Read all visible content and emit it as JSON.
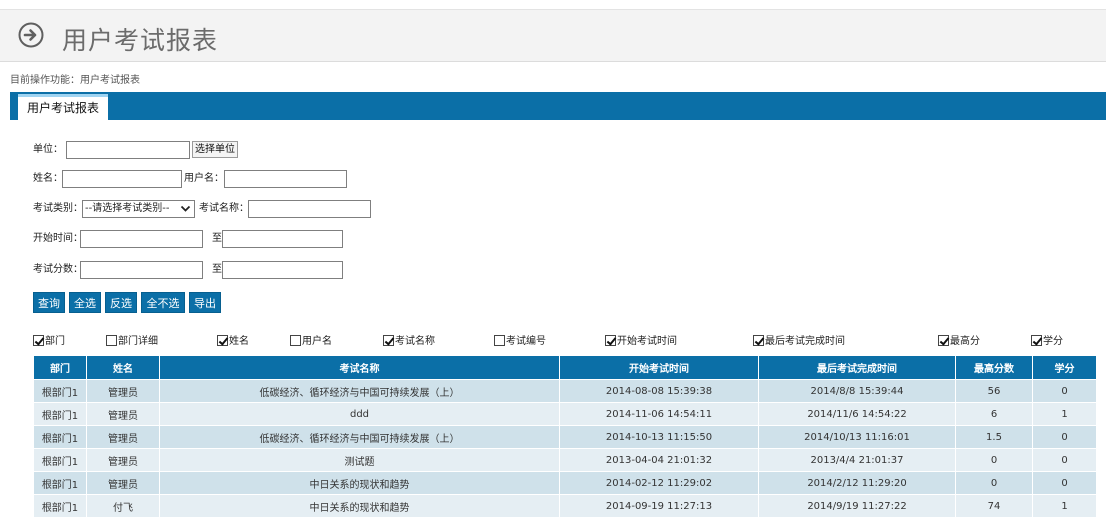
{
  "page": {
    "title": "用户考试报表",
    "breadcrumb": "目前操作功能：用户考试报表"
  },
  "tabs": [
    {
      "label": "用户考试报表",
      "active": true
    }
  ],
  "form": {
    "unit_label": "单位：",
    "unit_value": "",
    "unit_button": "选择单位",
    "name_label": "姓名：",
    "name_value": "",
    "username_label": "用户名：",
    "username_value": "",
    "category_label": "考试类别：",
    "category_selected": "--请选择考试类别--",
    "exam_name_label": "考试名称：",
    "exam_name_value": "",
    "start_label": "开始时间：",
    "start_from": "",
    "to_label": "至",
    "start_to": "",
    "score_label": "考试分数：",
    "score_from": "",
    "score_to": ""
  },
  "buttons": {
    "query": "查询",
    "select_all": "全选",
    "invert": "反选",
    "select_none": "全不选",
    "export": "导出"
  },
  "columns_toggle": [
    {
      "label": "部门",
      "checked": true
    },
    {
      "label": "部门详细",
      "checked": false
    },
    {
      "label": "姓名",
      "checked": true
    },
    {
      "label": "用户名",
      "checked": false
    },
    {
      "label": "考试名称",
      "checked": true
    },
    {
      "label": "考试编号",
      "checked": false
    },
    {
      "label": "开始考试时间",
      "checked": true
    },
    {
      "label": "最后考试完成时间",
      "checked": true
    },
    {
      "label": "最高分",
      "checked": true
    },
    {
      "label": "学分",
      "checked": true
    }
  ],
  "table": {
    "headers": [
      "部门",
      "姓名",
      "考试名称",
      "开始考试时间",
      "最后考试完成时间",
      "最高分数",
      "学分"
    ],
    "rows": [
      [
        "根部门1",
        "管理员",
        "低碳经济、循环经济与中国可持续发展（上）",
        "2014-08-08 15:39:38",
        "2014/8/8 15:39:44",
        "56",
        "0"
      ],
      [
        "根部门1",
        "管理员",
        "ddd",
        "2014-11-06 14:54:11",
        "2014/11/6 14:54:22",
        "6",
        "1"
      ],
      [
        "根部门1",
        "管理员",
        "低碳经济、循环经济与中国可持续发展（上）",
        "2014-10-13 11:15:50",
        "2014/10/13 11:16:01",
        "1.5",
        "0"
      ],
      [
        "根部门1",
        "管理员",
        "测试题",
        "2013-04-04 21:01:32",
        "2013/4/4 21:01:37",
        "0",
        "0"
      ],
      [
        "根部门1",
        "管理员",
        "中日关系的现状和趋势",
        "2014-02-12 11:29:02",
        "2014/2/12 11:29:20",
        "0",
        "0"
      ],
      [
        "根部门1",
        "付飞",
        "中日关系的现状和趋势",
        "2014-09-19 11:27:13",
        "2014/9/19 11:27:22",
        "74",
        "1"
      ]
    ]
  },
  "colors": {
    "primary": "#0b6fa7",
    "row_odd": "#cfe1ea",
    "row_even": "#e5eef3",
    "title_text": "#6b6b6b"
  },
  "icons": {
    "title": "arrow-right-circle-icon",
    "select": "chevron-down-icon",
    "checkbox": "check-icon"
  }
}
